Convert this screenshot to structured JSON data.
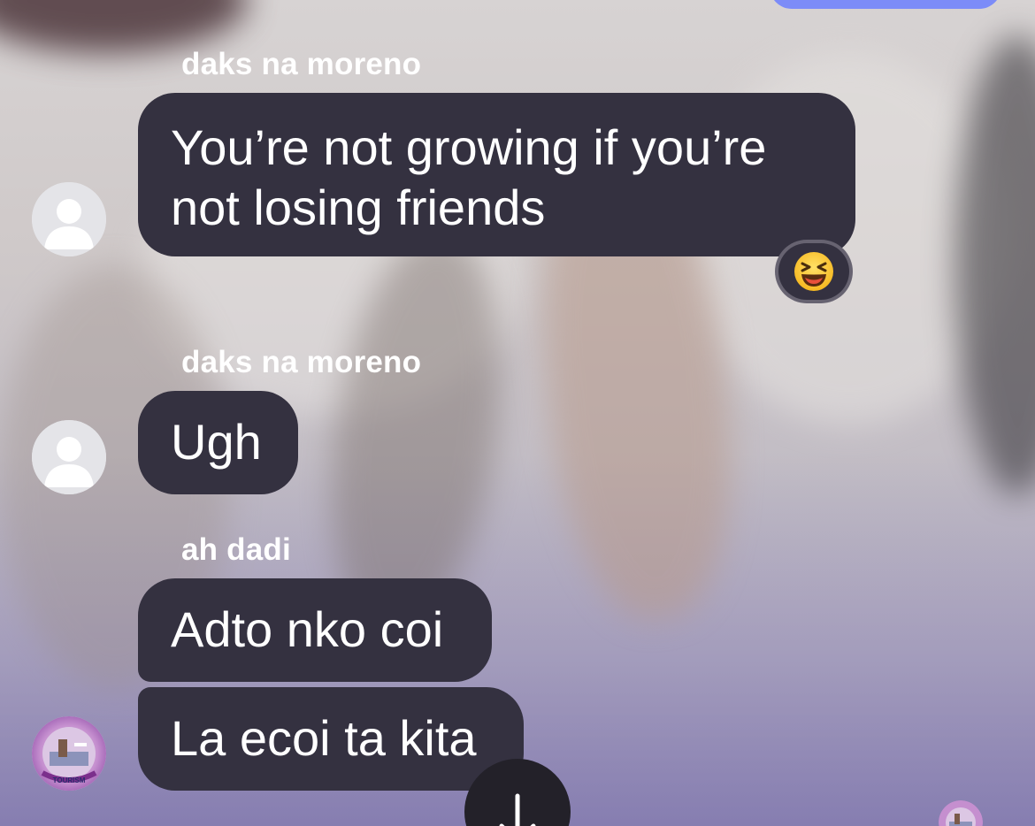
{
  "messages": [
    {
      "sender": "daks na moreno",
      "text": "You’re not growing if you’re not losing friends",
      "reaction": "grinning-squinting-face"
    },
    {
      "sender": "daks na moreno",
      "text": "Ugh"
    },
    {
      "sender": "ah dadi",
      "texts": [
        "Adto nko coi",
        "La ecoi ta kita"
      ]
    }
  ],
  "avatar_logo_text": "TOURISM",
  "icons": {
    "reaction": "grinning-squinting-face-icon",
    "scroll": "arrow-down-icon"
  },
  "colors": {
    "bubble": "#343140",
    "accent": "#7c8cf8",
    "text": "#ffffff"
  }
}
